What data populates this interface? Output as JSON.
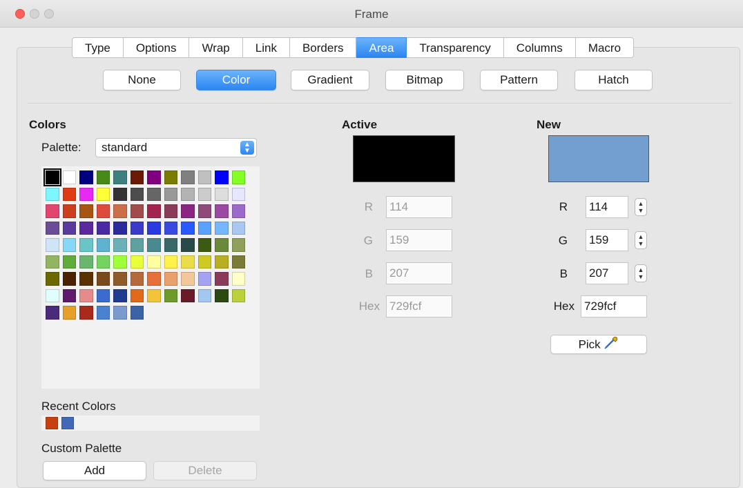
{
  "window": {
    "title": "Frame"
  },
  "tabs": [
    {
      "label": "Type",
      "active": false
    },
    {
      "label": "Options",
      "active": false
    },
    {
      "label": "Wrap",
      "active": false
    },
    {
      "label": "Link",
      "active": false
    },
    {
      "label": "Borders",
      "active": false
    },
    {
      "label": "Area",
      "active": true
    },
    {
      "label": "Transparency",
      "active": false
    },
    {
      "label": "Columns",
      "active": false
    },
    {
      "label": "Macro",
      "active": false
    }
  ],
  "fill_types": [
    "None",
    "Color",
    "Gradient",
    "Bitmap",
    "Pattern",
    "Hatch"
  ],
  "fill_active": "Color",
  "colors": {
    "heading": "Colors",
    "palette_label": "Palette:",
    "palette_value": "standard",
    "recent_label": "Recent Colors",
    "custom_label": "Custom Palette",
    "add_label": "Add",
    "delete_label": "Delete",
    "swatches": [
      "#000000",
      "#ffffff",
      "#000080",
      "#468a1a",
      "#3e8080",
      "#6b1a06",
      "#800080",
      "#7b7b00",
      "#808080",
      "#c0c0c0",
      "#0000ff",
      "#83ff26",
      "#7cf7ff",
      "#e03c12",
      "#e62af3",
      "#ffff35",
      "#333333",
      "#4d4d4d",
      "#666666",
      "#999999",
      "#b3b3b3",
      "#cccccc",
      "#dddddd",
      "#e6e6ff",
      "#e0466e",
      "#cc3e1e",
      "#a65513",
      "#dd4b3d",
      "#cc6e4a",
      "#a24b4b",
      "#a2254f",
      "#8b3a5a",
      "#8b2583",
      "#8f4a7a",
      "#9b4aa2",
      "#9b6acb",
      "#6b4d97",
      "#5a3a9c",
      "#5a2a9c",
      "#4a2aa2",
      "#2a2a9c",
      "#3a3acb",
      "#2a3ae0",
      "#3a4ae0",
      "#2a5aff",
      "#5aa2ff",
      "#74b6ff",
      "#a8c8f0",
      "#d0e4f8",
      "#87d7f7",
      "#6ac6c6",
      "#5fb2d0",
      "#6bb0b7",
      "#5fa0a0",
      "#4a8a8e",
      "#386868",
      "#2a4a4a",
      "#3d5a12",
      "#6a8a3a",
      "#8fa05a",
      "#92b562",
      "#5fac3a",
      "#6ab66e",
      "#74d45f",
      "#9fff3a",
      "#e9ff3a",
      "#ffffa0",
      "#fff04a",
      "#eadc4a",
      "#ceca22",
      "#b8b022",
      "#7b7b36",
      "#6b6800",
      "#4a2200",
      "#5a3200",
      "#7b4a1a",
      "#8f5a2a",
      "#b6693a",
      "#e6703a",
      "#eaa06b",
      "#f2c79a",
      "#a6a2f2",
      "#8b3a5a",
      "#ffffc8",
      "#e0ffff",
      "#5f1a6e",
      "#e68a8a",
      "#3b6bd0",
      "#1f3b8f",
      "#e06a1a",
      "#f2c43a",
      "#6e9a2a",
      "#6b1a2a",
      "#a2c8f2",
      "#2a4a12",
      "#bbd03a",
      "#4a2a7b",
      "#e6a02a",
      "#a82a1a",
      "#4a82d0",
      "#7b9ad0",
      "#3c63a6"
    ],
    "selected_index": 0,
    "recent": [
      "#c8400f",
      "#4468b8"
    ]
  },
  "active": {
    "heading": "Active",
    "color": "#000000",
    "r_label": "R",
    "r": "114",
    "g_label": "G",
    "g": "159",
    "b_label": "B",
    "b": "207",
    "hex_label": "Hex",
    "hex": "729fcf"
  },
  "new": {
    "heading": "New",
    "color": "#729fcf",
    "r_label": "R",
    "r": "114",
    "g_label": "G",
    "g": "159",
    "b_label": "B",
    "b": "207",
    "hex_label": "Hex",
    "hex": "729fcf",
    "pick_label": "Pick"
  },
  "icons": {
    "palette_arrow": "chevron-up-down-icon",
    "stepper": "stepper-icon",
    "pick": "eyedropper-icon"
  }
}
